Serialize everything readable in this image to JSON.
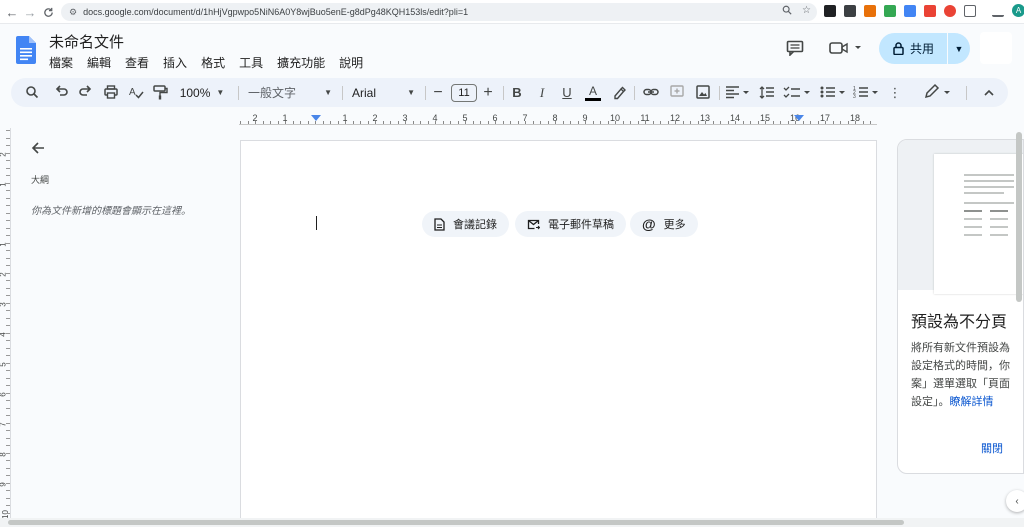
{
  "browser": {
    "back": "←",
    "forward": "→",
    "reload": "C",
    "url": "docs.google.com/document/d/1hHjVgpwpo5NiN6A0Y8wjBuo5enE-g8dPg48KQH153ls/edit?pli=1"
  },
  "header": {
    "title": "未命名文件",
    "menus": [
      "檔案",
      "編輯",
      "查看",
      "插入",
      "格式",
      "工具",
      "擴充功能",
      "說明"
    ],
    "share_label": "共用"
  },
  "toolbar": {
    "zoom": "100%",
    "style": "一般文字",
    "font": "Arial",
    "font_size": "11"
  },
  "ruler": [
    "2",
    "1",
    "1",
    "2",
    "3",
    "4",
    "5",
    "6",
    "7",
    "8",
    "9",
    "10",
    "11",
    "12",
    "13",
    "14",
    "15",
    "16",
    "17",
    "18"
  ],
  "vruler": [
    "2",
    "1",
    "1",
    "2",
    "3",
    "4",
    "5",
    "6",
    "7",
    "8",
    "9",
    "10",
    "11"
  ],
  "outline": {
    "title": "大綱",
    "hint": "你為文件新增的標題會顯示在這裡。"
  },
  "chips": [
    {
      "label": "會議記錄",
      "icon": "document-icon"
    },
    {
      "label": "電子郵件草稿",
      "icon": "email-draft-icon"
    },
    {
      "label": "更多",
      "icon": "at-icon"
    }
  ],
  "side_panel": {
    "title": "預設為不分頁",
    "body_lines": [
      "將所有新文件預設為",
      "設定格式的時間，你",
      "案」選單選取「頁面",
      "設定」。"
    ],
    "learn_more": "瞭解詳情",
    "close": "關閉"
  },
  "colors": {
    "accent": "#0b57d0",
    "share_bg": "#c2e7ff",
    "toolbar_bg": "#edf2fa",
    "doc_logo": "#4285f4"
  }
}
